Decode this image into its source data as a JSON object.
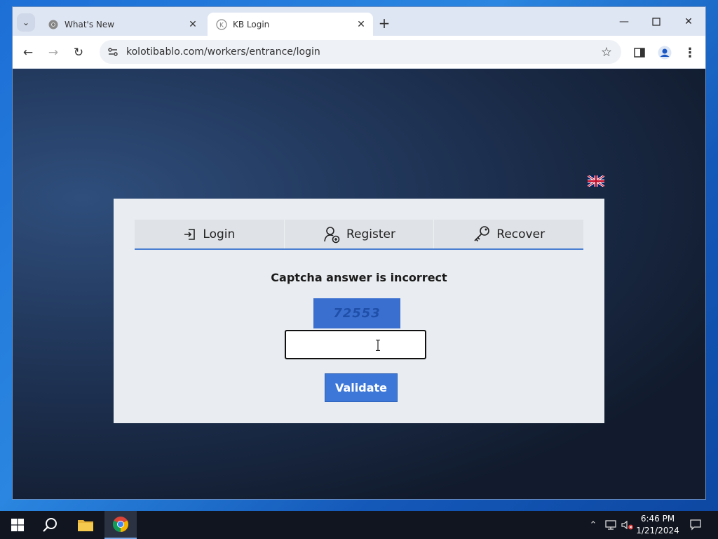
{
  "browser": {
    "tabs": [
      {
        "title": "What's New",
        "active": false,
        "favicon": "chrome-icon"
      },
      {
        "title": "KB Login",
        "active": true,
        "favicon": "kb-k-icon"
      }
    ],
    "url": "kolotibablo.com/workers/entrance/login",
    "window_controls": [
      "minimize",
      "maximize",
      "close"
    ]
  },
  "page": {
    "language_flag": "uk-flag-icon",
    "nav_tabs": [
      {
        "label": "Login",
        "icon": "login-icon"
      },
      {
        "label": "Register",
        "icon": "user-add-icon"
      },
      {
        "label": "Recover",
        "icon": "key-icon"
      }
    ],
    "error_message": "Captcha answer is incorrect",
    "captcha_text": "72553",
    "captcha_input": {
      "value": "",
      "placeholder": ""
    },
    "validate_label": "Validate",
    "colors": {
      "accent": "#3d78d8",
      "captcha_bg": "#3a6fd0",
      "card_bg": "#e9ecf0"
    }
  },
  "taskbar": {
    "items": [
      "windows-start-icon",
      "search-icon",
      "file-explorer-icon",
      "chrome-icon"
    ],
    "clock": {
      "time": "6:46 PM",
      "date": "1/21/2024"
    }
  }
}
